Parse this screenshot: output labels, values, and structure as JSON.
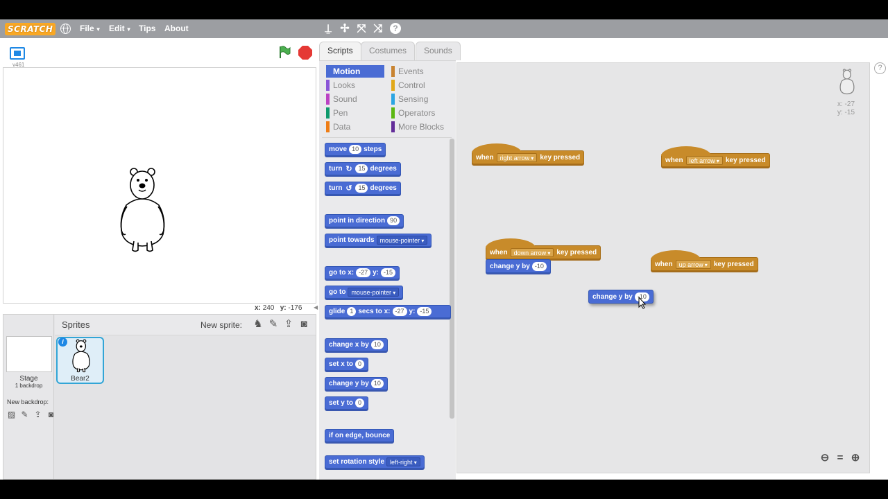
{
  "menubar": {
    "logo": "SCRATCH",
    "file": "File",
    "edit": "Edit",
    "tips": "Tips",
    "about": "About",
    "tools": [
      "duplicate-icon",
      "delete-icon",
      "grow-icon",
      "shrink-icon",
      "help-icon"
    ]
  },
  "stage": {
    "version": "v461",
    "mouse_x_label": "x:",
    "mouse_x": "240",
    "mouse_y_label": "y:",
    "mouse_y": "-176"
  },
  "sprite_pane": {
    "title": "Sprites",
    "new_sprite": "New sprite:",
    "stage_label": "Stage",
    "backdrop_count": "1 backdrop",
    "new_backdrop": "New backdrop:",
    "sprite_name": "Bear2"
  },
  "tabs": [
    "Scripts",
    "Costumes",
    "Sounds"
  ],
  "categories": {
    "motion": "Motion",
    "looks": "Looks",
    "sound": "Sound",
    "pen": "Pen",
    "data": "Data",
    "events": "Events",
    "control": "Control",
    "sensing": "Sensing",
    "operators": "Operators",
    "more": "More Blocks"
  },
  "colors": {
    "motion": "#4a6cd4",
    "looks": "#8a55d7",
    "sound": "#bb42c3",
    "pen": "#0e9a6c",
    "data": "#ee7d16",
    "events": "#c88330",
    "control": "#e1a91a",
    "sensing": "#2ca5e2",
    "operators": "#5cb712",
    "more": "#632d99"
  },
  "palette": {
    "move": {
      "a": "move",
      "v": "10",
      "b": "steps"
    },
    "turn_cw": {
      "a": "turn",
      "v": "15",
      "b": "degrees"
    },
    "turn_ccw": {
      "a": "turn",
      "v": "15",
      "b": "degrees"
    },
    "point_dir": {
      "a": "point in direction",
      "v": "90"
    },
    "point_towards": {
      "a": "point towards",
      "v": "mouse-pointer"
    },
    "goto_xy": {
      "a": "go to x:",
      "x": "-27",
      "b": "y:",
      "y": "-15"
    },
    "goto": {
      "a": "go to",
      "v": "mouse-pointer"
    },
    "glide": {
      "a": "glide",
      "s": "1",
      "b": "secs to x:",
      "x": "-27",
      "c": "y:",
      "y": "-15"
    },
    "change_x": {
      "a": "change x by",
      "v": "10"
    },
    "set_x": {
      "a": "set x to",
      "v": "0"
    },
    "change_y": {
      "a": "change y by",
      "v": "10"
    },
    "set_y": {
      "a": "set y to",
      "v": "0"
    },
    "bounce": {
      "a": "if on edge, bounce"
    },
    "rotation": {
      "a": "set rotation style",
      "v": "left-right"
    }
  },
  "scripts": {
    "s1": {
      "when": "when",
      "key": "right arrow",
      "pressed": "key pressed"
    },
    "s2": {
      "when": "when",
      "key": "left arrow",
      "pressed": "key pressed"
    },
    "s3": {
      "when": "when",
      "key": "down arrow",
      "pressed": "key pressed",
      "cmd": "change y by",
      "val": "-10"
    },
    "s4": {
      "when": "when",
      "key": "up arrow",
      "pressed": "key pressed"
    },
    "loose": {
      "cmd": "change y by",
      "val": "-10"
    }
  },
  "script_area": {
    "x": "x: -27",
    "y": "y: -15"
  }
}
